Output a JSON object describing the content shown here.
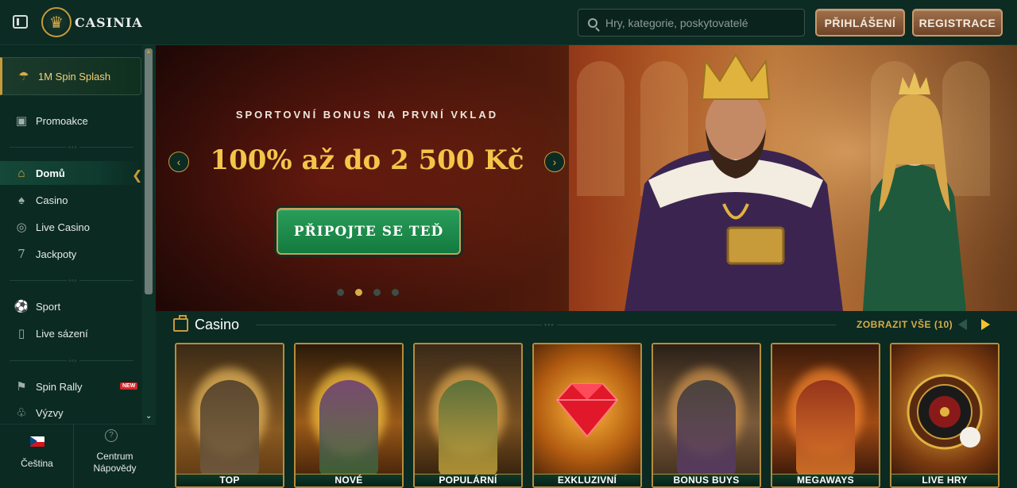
{
  "header": {
    "brand": "CASINIA",
    "search_placeholder": "Hry, kategorie, poskytovatelé",
    "login_label": "PŘIHLÁŠENÍ",
    "register_label": "REGISTRACE"
  },
  "sidebar": {
    "promo_item": "1M Spin Splash",
    "items": [
      {
        "label": "Promoakce",
        "icon": "gift-icon"
      },
      {
        "label": "Domů",
        "icon": "home-icon"
      },
      {
        "label": "Casino",
        "icon": "cards-icon"
      },
      {
        "label": "Live Casino",
        "icon": "chip-icon"
      },
      {
        "label": "Jackpoty",
        "icon": "seven-icon"
      },
      {
        "label": "Sport",
        "icon": "soccer-ball-icon"
      },
      {
        "label": "Live sázení",
        "icon": "live-bet-icon"
      },
      {
        "label": "Spin Rally",
        "icon": "flag-icon"
      },
      {
        "label": "Výzvy",
        "icon": "challenge-icon"
      }
    ],
    "new_badge": "NEW",
    "language_label": "Čeština",
    "help_label_line1": "Centrum",
    "help_label_line2": "Nápovědy"
  },
  "hero": {
    "subtitle": "SPORTOVNÍ BONUS NA PRVNÍ VKLAD",
    "title": "100% až do 2 500 Kč",
    "cta_label": "PŘIPOJTE SE TEĎ",
    "slide_count": 4,
    "active_slide": 2
  },
  "casino": {
    "title": "Casino",
    "view_all": "ZOBRAZIT VŠE (10)",
    "cards": [
      {
        "label": "TOP"
      },
      {
        "label": "NOVÉ"
      },
      {
        "label": "POPULÁRNÍ"
      },
      {
        "label": "EXKLUZIVNÍ"
      },
      {
        "label": "BONUS BUYS"
      },
      {
        "label": "MEGAWAYS"
      },
      {
        "label": "LIVE HRY"
      }
    ]
  },
  "colors": {
    "background": "#0b2a22",
    "gold_accent": "#d8ad4a",
    "cta_green": "#1f8b4c",
    "header_button": "#8a5a38"
  }
}
